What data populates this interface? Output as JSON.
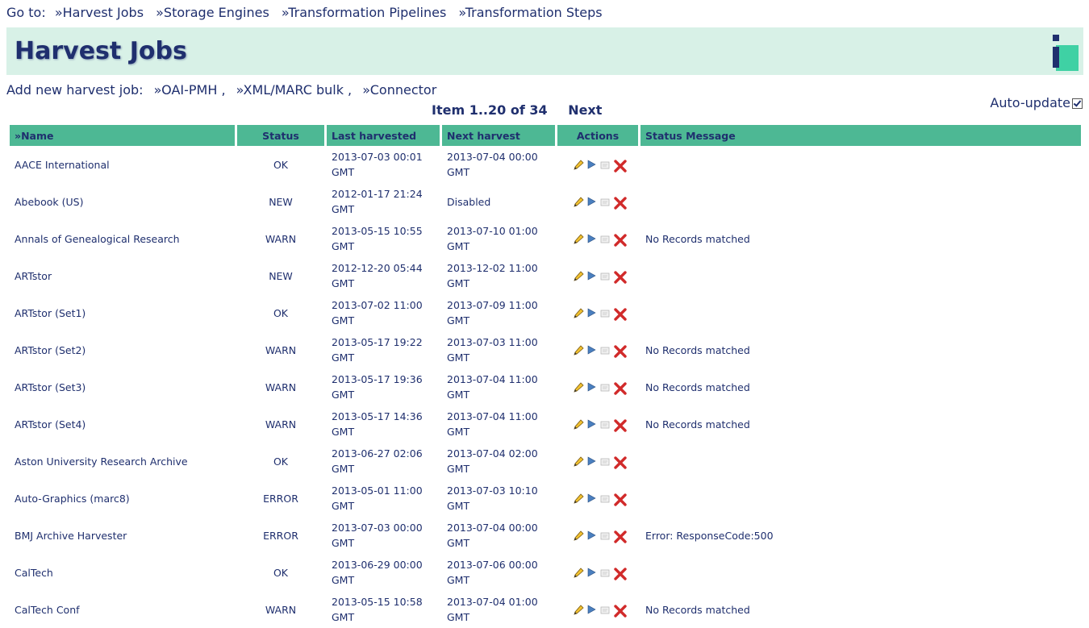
{
  "nav": {
    "label": "Go to:",
    "links": [
      "»Harvest Jobs",
      "»Storage Engines",
      "»Transformation Pipelines",
      "»Transformation Steps"
    ]
  },
  "header": {
    "title": "Harvest Jobs"
  },
  "add_new": {
    "label": "Add new harvest job:",
    "links": [
      "»OAI-PMH ,",
      "»XML/MARC bulk ,",
      "»Connector"
    ]
  },
  "pager": {
    "range": "Item 1..20 of 34",
    "next": "Next"
  },
  "auto_update": {
    "label": "Auto-update",
    "checked": true
  },
  "table": {
    "headers": {
      "name": "»Name",
      "status": "Status",
      "last": "Last harvested",
      "next": "Next harvest",
      "actions": "Actions",
      "message": "Status Message"
    },
    "rows": [
      {
        "name": "AACE International",
        "status": "OK",
        "last1": "2013-07-03 00:01",
        "last2": "GMT",
        "next1": "2013-07-04 00:00",
        "next2": "GMT",
        "message": ""
      },
      {
        "name": "Abebook (US)",
        "status": "NEW",
        "last1": "2012-01-17 21:24",
        "last2": "GMT",
        "next1": "Disabled",
        "next2": "",
        "message": ""
      },
      {
        "name": "Annals of Genealogical Research",
        "status": "WARN",
        "last1": "2013-05-15 10:55",
        "last2": "GMT",
        "next1": "2013-07-10 01:00",
        "next2": "GMT",
        "message": "No Records matched"
      },
      {
        "name": "ARTstor",
        "status": "NEW",
        "last1": "2012-12-20 05:44",
        "last2": "GMT",
        "next1": "2013-12-02 11:00",
        "next2": "GMT",
        "message": ""
      },
      {
        "name": "ARTstor (Set1)",
        "status": "OK",
        "last1": "2013-07-02 11:00",
        "last2": "GMT",
        "next1": "2013-07-09 11:00",
        "next2": "GMT",
        "message": ""
      },
      {
        "name": "ARTstor (Set2)",
        "status": "WARN",
        "last1": "2013-05-17 19:22",
        "last2": "GMT",
        "next1": "2013-07-03 11:00",
        "next2": "GMT",
        "message": "No Records matched"
      },
      {
        "name": "ARTstor (Set3)",
        "status": "WARN",
        "last1": "2013-05-17 19:36",
        "last2": "GMT",
        "next1": "2013-07-04 11:00",
        "next2": "GMT",
        "message": "No Records matched"
      },
      {
        "name": "ARTstor (Set4)",
        "status": "WARN",
        "last1": "2013-05-17 14:36",
        "last2": "GMT",
        "next1": "2013-07-04 11:00",
        "next2": "GMT",
        "message": "No Records matched"
      },
      {
        "name": "Aston University Research Archive",
        "status": "OK",
        "last1": "2013-06-27 02:06",
        "last2": "GMT",
        "next1": "2013-07-04 02:00",
        "next2": "GMT",
        "message": ""
      },
      {
        "name": "Auto-Graphics (marc8)",
        "status": "ERROR",
        "last1": "2013-05-01 11:00",
        "last2": "GMT",
        "next1": "2013-07-03 10:10",
        "next2": "GMT",
        "message": ""
      },
      {
        "name": "BMJ Archive Harvester",
        "status": "ERROR",
        "last1": "2013-07-03 00:00",
        "last2": "GMT",
        "next1": "2013-07-04 00:00",
        "next2": "GMT",
        "message": "Error: ResponseCode:500"
      },
      {
        "name": "CalTech",
        "status": "OK",
        "last1": "2013-06-29 00:00",
        "last2": "GMT",
        "next1": "2013-07-06 00:00",
        "next2": "GMT",
        "message": ""
      },
      {
        "name": "CalTech Conf",
        "status": "WARN",
        "last1": "2013-05-15 10:58",
        "last2": "GMT",
        "next1": "2013-07-04 01:00",
        "next2": "GMT",
        "message": "No Records matched"
      }
    ]
  },
  "icons": [
    "edit-icon",
    "run-icon",
    "log-icon",
    "delete-icon"
  ],
  "colors": {
    "header_bg": "#4db894",
    "banner_bg": "#d8f1e7",
    "text": "#1f2f6e",
    "logo_accent": "#3fd1a4"
  }
}
